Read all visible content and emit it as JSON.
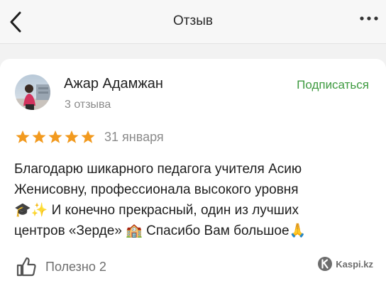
{
  "header": {
    "title": "Отзыв",
    "back_icon": "chevron-left-icon",
    "more_icon": "more-dots-icon"
  },
  "review": {
    "author": "Ажар Адамжан",
    "reviews_count": "3 отзыва",
    "subscribe_label": "Подписаться",
    "rating": 5,
    "rating_max": 5,
    "date": "31 января",
    "text_lines": [
      "Благодарю шикарного педагога учителя Асию",
      "Женисовну, профессионала высокого уровня",
      "🎓✨ И конечно прекрасный, один из лучших",
      "центров «Зерде» 🏫 Спасибо Вам большое🙏"
    ],
    "helpful_label": "Полезно 2"
  },
  "watermark": {
    "text": "Kaspi.kz"
  },
  "colors": {
    "accent_green": "#3d9a3f",
    "star_orange": "#f29a1f",
    "muted_text": "#8b8b8b"
  }
}
